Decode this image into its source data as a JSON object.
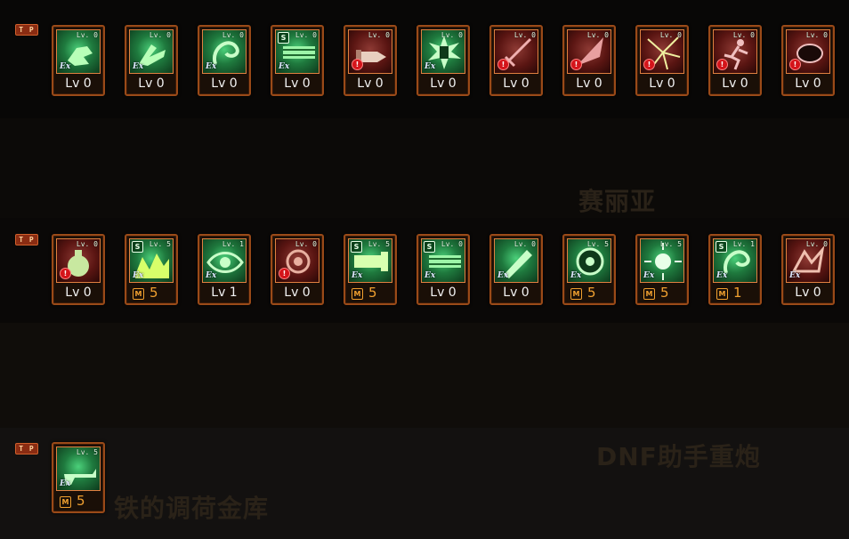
{
  "tp_label": "T P",
  "ghost_texts": [
    "赛丽亚",
    "DNF助手重炮",
    "铁的调荷金库"
  ],
  "rows": [
    {
      "name": "row-1",
      "skills": [
        {
          "style": "green",
          "tag": "Lv. 0",
          "badge": "ex",
          "caption": "Lv 0",
          "glyph": "fist"
        },
        {
          "style": "green",
          "tag": "Lv. 0",
          "badge": "ex",
          "caption": "Lv 0",
          "glyph": "kick"
        },
        {
          "style": "green",
          "tag": "Lv. 0",
          "badge": "ex",
          "caption": "Lv 0",
          "glyph": "swirl"
        },
        {
          "style": "green",
          "tag": "Lv. 0",
          "s": "S",
          "badge": "ex",
          "caption": "Lv 0",
          "glyph": "beam"
        },
        {
          "style": "red",
          "tag": "Lv. 0",
          "badge": "warn",
          "caption": "Lv 0",
          "glyph": "shell"
        },
        {
          "style": "green",
          "tag": "Lv. 0",
          "badge": "ex",
          "caption": "Lv 0",
          "glyph": "burst"
        },
        {
          "style": "red",
          "tag": "Lv. 0",
          "badge": "warn",
          "caption": "Lv 0",
          "glyph": "sword"
        },
        {
          "style": "red",
          "tag": "Lv. 0",
          "badge": "warn",
          "caption": "Lv 0",
          "glyph": "slash"
        },
        {
          "style": "red",
          "tag": "Lv. 0",
          "badge": "warn",
          "caption": "Lv 0",
          "glyph": "spark"
        },
        {
          "style": "red",
          "tag": "Lv. 0",
          "badge": "warn",
          "caption": "Lv 0",
          "glyph": "runner"
        },
        {
          "style": "red",
          "tag": "Lv. 0",
          "badge": "warn",
          "caption": "Lv 0",
          "glyph": "blob"
        }
      ]
    },
    {
      "name": "row-2",
      "skills": [
        {
          "style": "red",
          "tag": "Lv. 0",
          "badge": "warn",
          "caption": "Lv 0",
          "glyph": "grenade"
        },
        {
          "style": "green",
          "tag": "Lv. 5",
          "s": "S",
          "badge": "ex",
          "caption_m": "5",
          "glyph": "wave"
        },
        {
          "style": "green",
          "tag": "Lv. 1",
          "badge": "ex",
          "caption": "Lv 1",
          "glyph": "eye"
        },
        {
          "style": "red",
          "tag": "Lv. 0",
          "badge": "warn",
          "caption": "Lv 0",
          "glyph": "coil"
        },
        {
          "style": "green",
          "tag": "Lv. 5",
          "s": "S",
          "badge": "ex",
          "caption_m": "5",
          "glyph": "cannon"
        },
        {
          "style": "green",
          "tag": "Lv. 0",
          "s": "S",
          "badge": "ex",
          "caption": "Lv 0",
          "glyph": "beam"
        },
        {
          "style": "green",
          "tag": "Lv. 0",
          "badge": "ex",
          "caption": "Lv 0",
          "glyph": "missile"
        },
        {
          "style": "green",
          "tag": "Lv. 5",
          "badge": "ex",
          "caption_m": "5",
          "glyph": "ball"
        },
        {
          "style": "green",
          "tag": "Lv. 5",
          "badge": "ex",
          "caption_m": "5",
          "glyph": "sun"
        },
        {
          "style": "green",
          "tag": "Lv. 1",
          "s": "S",
          "badge": "ex",
          "caption_m": "1",
          "glyph": "swirl"
        },
        {
          "style": "red",
          "tag": "Lv. 0",
          "badge": "ex",
          "caption": "Lv 0",
          "glyph": "claw"
        }
      ]
    },
    {
      "name": "row-3",
      "skills": [
        {
          "style": "green",
          "tag": "Lv. 5",
          "badge": "ex",
          "caption_m": "5",
          "glyph": "gun"
        }
      ]
    }
  ],
  "m_badge_label": "M",
  "ex_label": "Ex",
  "warn_label": "!",
  "colors": {
    "frame": "#9a4a18",
    "green": "#3fbf6a",
    "red": "#7a1e1a",
    "mastery": "#f0a030"
  }
}
